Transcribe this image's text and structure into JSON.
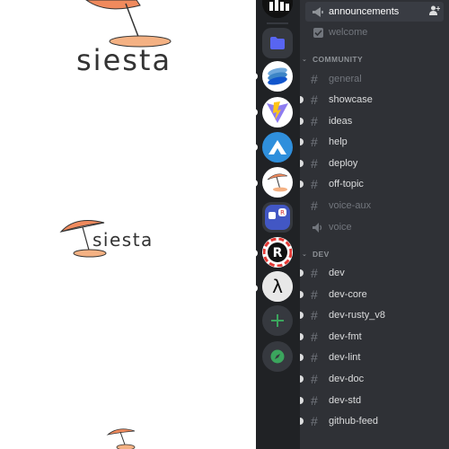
{
  "canvas": {
    "logo_large_text": "siesta",
    "logo_medium_text": "siesta"
  },
  "server_rail": {
    "servers": [
      {
        "name": "direct-messages",
        "icon": "folder-icon"
      },
      {
        "name": "deno",
        "icon": "layers-logo-icon"
      },
      {
        "name": "vite",
        "icon": "vite-logo-icon"
      },
      {
        "name": "mountain",
        "icon": "mountain-logo-icon"
      },
      {
        "name": "siesta",
        "icon": "umbrella-logo-icon"
      },
      {
        "name": "apps",
        "icon": "apps-logo-icon"
      },
      {
        "name": "rust",
        "icon": "rust-logo-icon"
      },
      {
        "name": "lambda",
        "icon": "lambda-logo-icon"
      }
    ],
    "add_server_icon": "plus-icon",
    "explore_icon": "compass-icon"
  },
  "channels": {
    "top": [
      {
        "name": "announcements",
        "type": "announcement",
        "state": "selected"
      },
      {
        "name": "welcome",
        "type": "rules",
        "state": "muted"
      }
    ],
    "categories": [
      {
        "name": "COMMUNITY",
        "channels": [
          {
            "name": "general",
            "type": "text",
            "state": "muted"
          },
          {
            "name": "showcase",
            "type": "text",
            "state": "unread"
          },
          {
            "name": "ideas",
            "type": "text",
            "state": "unread"
          },
          {
            "name": "help",
            "type": "text",
            "state": "unread"
          },
          {
            "name": "deploy",
            "type": "text",
            "state": "unread"
          },
          {
            "name": "off-topic",
            "type": "text",
            "state": "unread"
          },
          {
            "name": "voice-aux",
            "type": "text",
            "state": "muted"
          },
          {
            "name": "voice",
            "type": "voice",
            "state": "muted"
          }
        ]
      },
      {
        "name": "DEV",
        "channels": [
          {
            "name": "dev",
            "type": "text",
            "state": "unread"
          },
          {
            "name": "dev-core",
            "type": "text",
            "state": "unread"
          },
          {
            "name": "dev-rusty_v8",
            "type": "text",
            "state": "unread"
          },
          {
            "name": "dev-fmt",
            "type": "text",
            "state": "unread"
          },
          {
            "name": "dev-lint",
            "type": "text",
            "state": "unread"
          },
          {
            "name": "dev-doc",
            "type": "text",
            "state": "unread"
          },
          {
            "name": "dev-std",
            "type": "text",
            "state": "unread"
          },
          {
            "name": "github-feed",
            "type": "text",
            "state": "unread"
          }
        ]
      }
    ]
  },
  "colors": {
    "rail_bg": "#202225",
    "sidebar_bg": "#2f3136",
    "umbrella_orange": "#f08a5d",
    "sand": "#f4b183",
    "blurple": "#5865f2",
    "green": "#3ba55d"
  }
}
